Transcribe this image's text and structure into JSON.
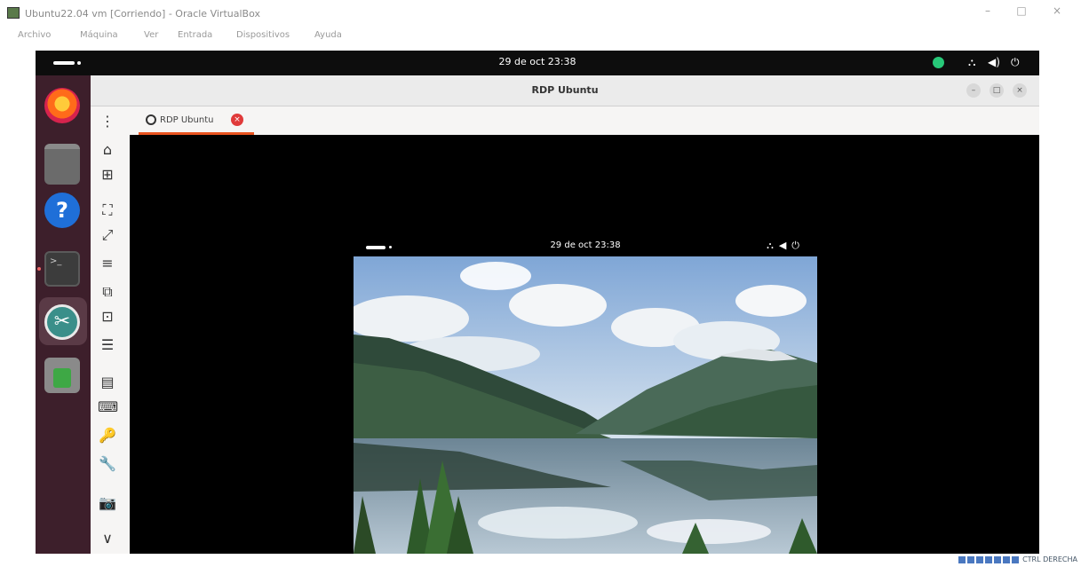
{
  "host_window": {
    "title": "Ubuntu22.04 vm [Corriendo] - Oracle VirtualBox",
    "menu": [
      "Archivo",
      "Máquina",
      "Ver",
      "Entrada",
      "Dispositivos",
      "Ayuda"
    ],
    "controls": {
      "minimize": "–",
      "maximize": "□",
      "close": "×"
    }
  },
  "guest_topbar": {
    "clock": "29 de oct 23:38",
    "status_icons": [
      "network-icon",
      "volume-icon",
      "power-icon"
    ],
    "glyphs": {
      "network": "⛬",
      "volume": "◀)",
      "power": "⏻"
    },
    "green_indicator_color": "#27c878"
  },
  "dock": {
    "items": [
      {
        "name": "firefox",
        "icon": "firefox-icon"
      },
      {
        "name": "files",
        "icon": "files-icon"
      },
      {
        "name": "help",
        "icon": "help-icon",
        "glyph": "?"
      },
      {
        "name": "terminal",
        "icon": "terminal-icon",
        "glyph": ">_"
      },
      {
        "name": "remmina",
        "icon": "remmina-icon",
        "glyph": "✂"
      },
      {
        "name": "trash",
        "icon": "trash-icon"
      }
    ]
  },
  "remmina": {
    "window_title": "RDP Ubuntu",
    "tab": {
      "label": "RDP Ubuntu",
      "close": "×"
    },
    "toolbar_menu_glyph": "⋮",
    "toolbar_glyphs": {
      "home": "⌂",
      "new": "⊞",
      "fit": "⛶",
      "fullscreen": "⤢",
      "scale": "≡",
      "dynres": "⧉",
      "viewport": "⊡",
      "menu": "☰",
      "multi": "▤",
      "keyboard": "⌨",
      "keys": "🔑",
      "tools": "🔧",
      "screenshot": "📷",
      "more": "∨"
    },
    "accent_color": "#e95420"
  },
  "remote_desktop": {
    "clock": "29 de oct 23:38",
    "status_glyphs": "⛬◀⏻"
  },
  "host_tray": {
    "keyboard_text": "CTRL DERECHA"
  }
}
